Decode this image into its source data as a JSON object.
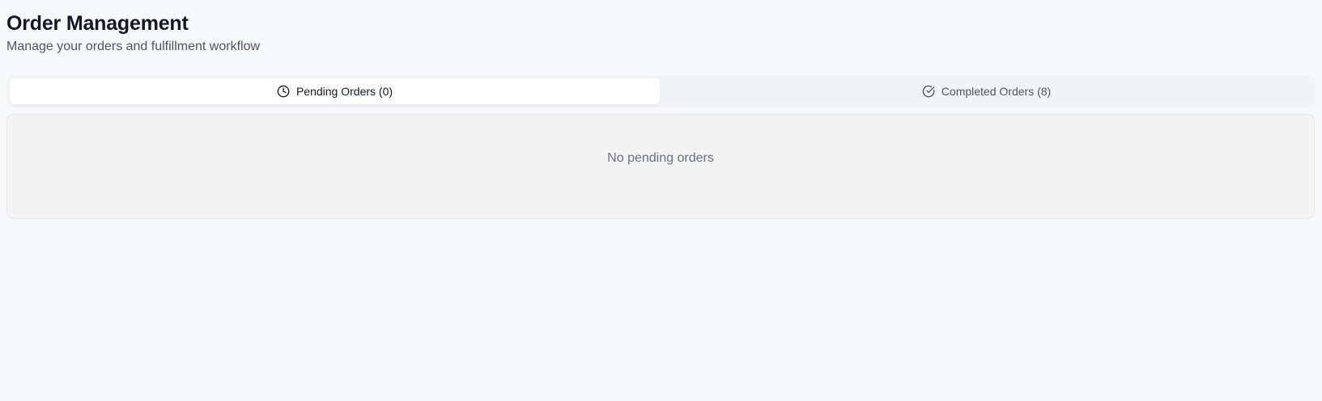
{
  "header": {
    "title": "Order Management",
    "subtitle": "Manage your orders and fulfillment workflow"
  },
  "tabs": [
    {
      "label": "Pending Orders (0)",
      "icon": "clock-icon",
      "active": true
    },
    {
      "label": "Completed Orders (8)",
      "icon": "check-circle-icon",
      "active": false
    }
  ],
  "panel": {
    "empty_message": "No pending orders"
  },
  "colors": {
    "background": "#f8f9fb",
    "tab_bar": "#f3f4f6",
    "active_tab": "#ffffff",
    "text_primary": "#111827",
    "text_secondary": "#4b5563",
    "text_muted": "#6b7280"
  }
}
